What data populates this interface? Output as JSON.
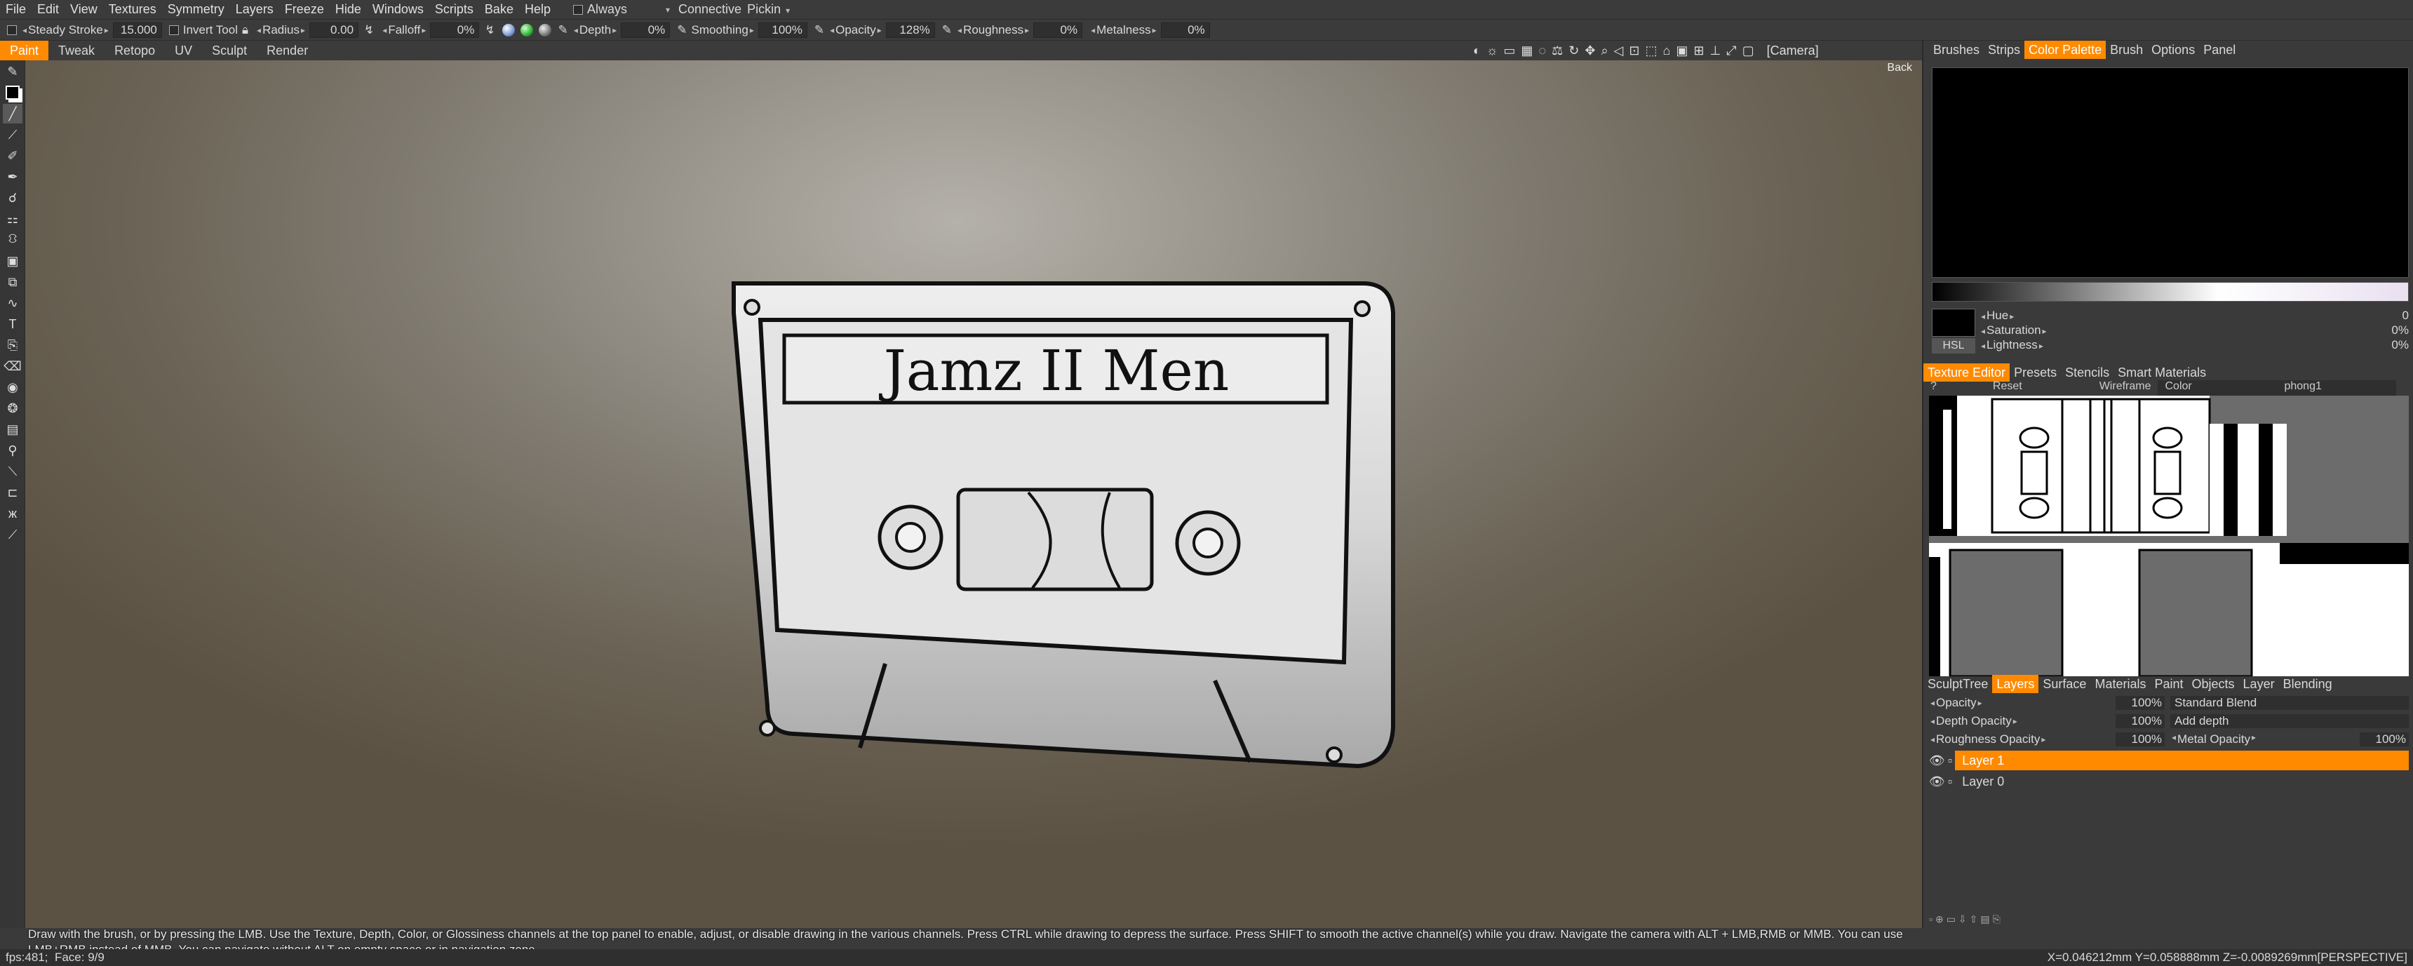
{
  "menubar": {
    "items": [
      "File",
      "Edit",
      "View",
      "Textures",
      "Symmetry",
      "Layers",
      "Freeze",
      "Hide",
      "Windows",
      "Scripts",
      "Bake",
      "Help"
    ],
    "always_label": "Always",
    "connective_label": "Connective",
    "pickin_label": "Pickin"
  },
  "toolbar": {
    "steady_stroke_label": "Steady",
    "stroke_label": "Stroke",
    "stroke_value": "15.000",
    "invert_tool_label": "Invert Tool",
    "radius_label": "Radius",
    "radius_value": "0.00",
    "falloff_label": "Falloff",
    "falloff_value": "0%",
    "depth_label": "Depth",
    "depth_value": "0%",
    "smoothing_label": "Smoothing",
    "smoothing_value": "100%",
    "opacity_label": "Opacity",
    "opacity_value": "128%",
    "roughness_label": "Roughness",
    "roughness_value": "0%",
    "metalness_label": "Metalness",
    "metalness_value": "0%"
  },
  "rooms": {
    "items": [
      "Paint",
      "Tweak",
      "Retopo",
      "UV",
      "Sculpt",
      "Render"
    ],
    "active": "Paint"
  },
  "viewport": {
    "camera_label": "[Camera]",
    "back_label": "Back",
    "cassette_label_text": "Jamz II Men",
    "hint": "Draw with the brush, or by pressing the LMB. Use the Texture, Depth, Color, or Glossiness channels at the top panel to enable, adjust, or disable drawing in the various channels. Press CTRL while drawing to depress the surface. Press SHIFT to smooth the active channel(s) while you draw. Navigate the camera with ALT + LMB,RMB or MMB. You can use LMB+RMB instead of MMB. You can navigate without ALT on empty space or in navigation zone"
  },
  "right_panel": {
    "top_tabs": [
      "Brushes",
      "Strips",
      "Color Palette",
      "Brush",
      "Options",
      "Panel"
    ],
    "top_active": "Color Palette",
    "hsl_button": "HSL",
    "hue_label": "Hue",
    "hue_value": "0",
    "saturation_label": "Saturation",
    "saturation_value": "0%",
    "lightness_label": "Lightness",
    "lightness_value": "0%",
    "tex_tabs": [
      "Texture Editor",
      "Presets",
      "Stencils",
      "Smart Materials"
    ],
    "tex_active": "Texture Editor",
    "tex_toolbar": [
      "?",
      "Reset",
      "Wireframe",
      "Color",
      "phong1"
    ],
    "layer_tabs": [
      "SculptTree",
      "Layers",
      "Surface",
      "Materials",
      "Paint",
      "Objects",
      "Layer",
      "Blending"
    ],
    "layer_active": "Layers",
    "opacity_label": "Opacity",
    "opacity_value": "100%",
    "blend_mode": "Standard Blend",
    "depth_opacity_label": "Depth Opacity",
    "depth_opacity_value": "100%",
    "add_depth": "Add depth",
    "roughness_opacity_label": "Roughness Opacity",
    "roughness_opacity_value": "100%",
    "metal_opacity_label": "Metal Opacity",
    "metal_opacity_value": "100%",
    "layers": [
      "Layer 1",
      "Layer 0"
    ]
  },
  "statusbar": {
    "fps": "fps:481;",
    "face": "Face: 9/9",
    "coords": "X=0.046212mm Y=0.058888mm Z=-0.0089269mm[PERSPECTIVE]"
  },
  "colors": {
    "accent": "#ff8a00"
  }
}
